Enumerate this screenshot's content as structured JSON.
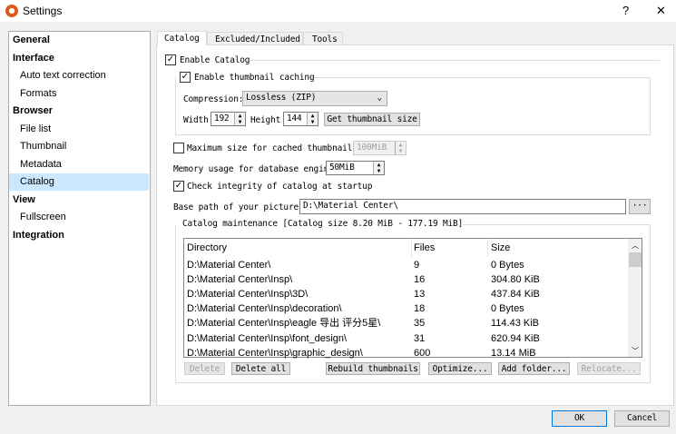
{
  "window": {
    "title": "Settings",
    "help": "?",
    "close": "✕"
  },
  "sidebar": {
    "items": [
      {
        "label": "General",
        "type": "header"
      },
      {
        "label": "Interface",
        "type": "header"
      },
      {
        "label": "Auto text correction",
        "type": "sub"
      },
      {
        "label": "Formats",
        "type": "sub"
      },
      {
        "label": "Browser",
        "type": "header"
      },
      {
        "label": "File list",
        "type": "sub"
      },
      {
        "label": "Thumbnail",
        "type": "sub"
      },
      {
        "label": "Metadata",
        "type": "sub"
      },
      {
        "label": "Catalog",
        "type": "sub",
        "selected": true
      },
      {
        "label": "View",
        "type": "header"
      },
      {
        "label": "Fullscreen",
        "type": "sub"
      },
      {
        "label": "Integration",
        "type": "header"
      }
    ]
  },
  "tabs": [
    {
      "label": "Catalog",
      "active": true
    },
    {
      "label": "Excluded/Included"
    },
    {
      "label": "Tools"
    }
  ],
  "catalog": {
    "enable_catalog": {
      "label": "Enable Catalog",
      "checked": true
    },
    "thumb_cache": {
      "label": "Enable thumbnail caching",
      "checked": true
    },
    "compression_label": "Compression:",
    "compression_value": "Lossless (ZIP)",
    "width_label": "Width",
    "width_value": "192",
    "height_label": "Height",
    "height_value": "144",
    "get_size": "Get thumbnail size",
    "max_size": {
      "label": "Maximum size for cached thumbnails",
      "checked": false,
      "value": "100MiB"
    },
    "memory_label": "Memory usage for database engine",
    "memory_value": "50MiB",
    "integrity": {
      "label": "Check integrity of catalog at startup",
      "checked": true
    },
    "base_path_label": "Base path of your pictures",
    "base_path_value": "D:\\Material Center\\",
    "browse": "···",
    "maintenance_label": "Catalog maintenance [Catalog size 8.20 MiB - 177.19 MiB]",
    "columns": [
      "Directory",
      "Files",
      "Size"
    ],
    "rows": [
      [
        "D:\\Material Center\\",
        "9",
        "0 Bytes"
      ],
      [
        "D:\\Material Center\\Insp\\",
        "16",
        "304.80 KiB"
      ],
      [
        "D:\\Material Center\\Insp\\3D\\",
        "13",
        "437.84 KiB"
      ],
      [
        "D:\\Material Center\\Insp\\decoration\\",
        "18",
        "0 Bytes"
      ],
      [
        "D:\\Material Center\\Insp\\eagle 导出 评分5星\\",
        "35",
        "114.43 KiB"
      ],
      [
        "D:\\Material Center\\Insp\\font_design\\",
        "31",
        "620.94 KiB"
      ],
      [
        "D:\\Material Center\\Insp\\graphic_design\\",
        "600",
        "13.14 MiB"
      ]
    ],
    "buttons": {
      "delete": "Delete",
      "delete_all": "Delete all",
      "rebuild": "Rebuild thumbnails",
      "optimize": "Optimize...",
      "add_folder": "Add folder...",
      "relocate": "Relocate..."
    }
  },
  "footer": {
    "ok": "OK",
    "cancel": "Cancel"
  }
}
